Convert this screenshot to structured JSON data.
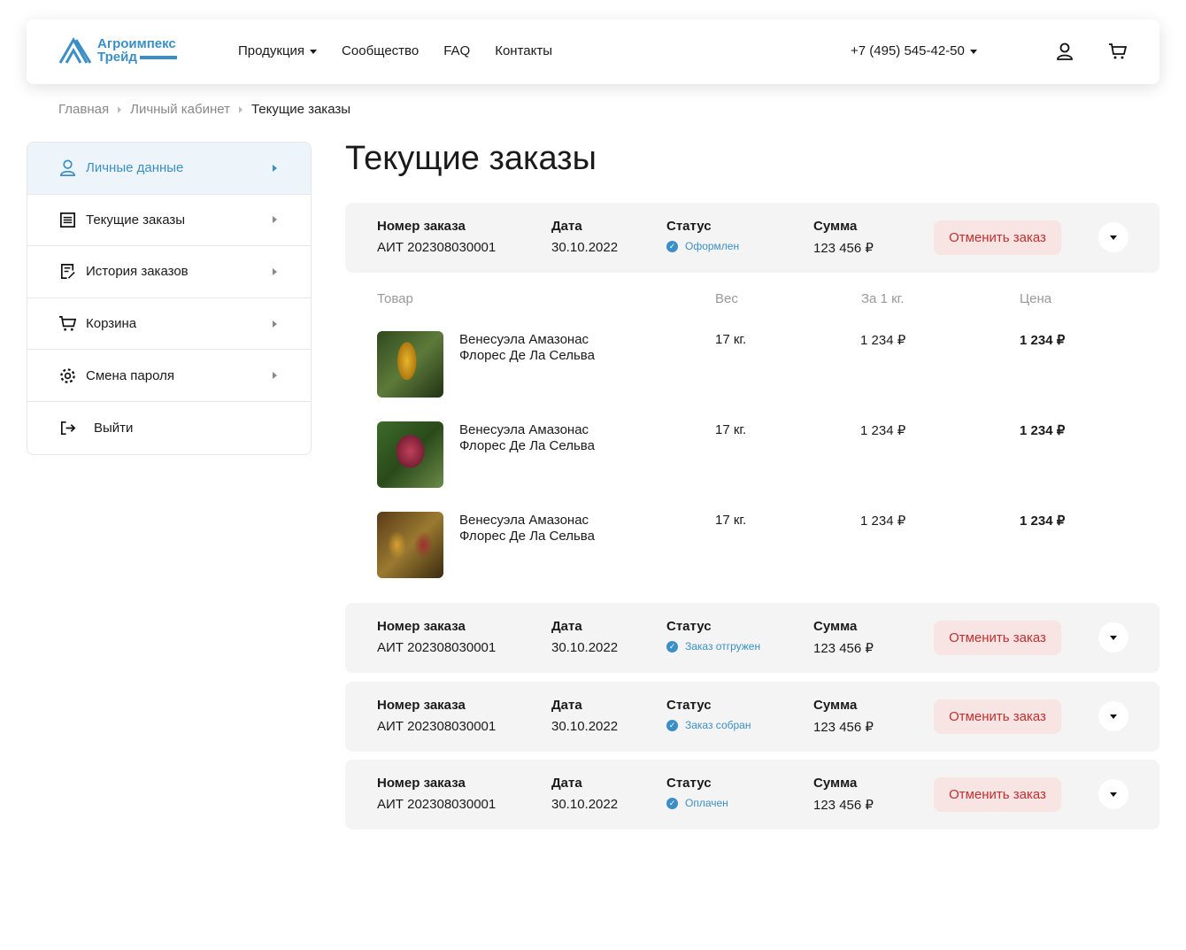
{
  "header": {
    "logo": {
      "line1": "Агроимпекс",
      "line2": "Трейд"
    },
    "nav": [
      {
        "label": "Продукция",
        "dropdown": true
      },
      {
        "label": "Сообщество"
      },
      {
        "label": "FAQ"
      },
      {
        "label": "Контакты"
      }
    ],
    "phone": "+7 (495) 545-42-50",
    "icons": [
      "user-icon",
      "cart-icon"
    ]
  },
  "breadcrumbs": [
    "Главная",
    "Личный кабинет",
    "Текущие заказы"
  ],
  "sidebar": {
    "items": [
      {
        "label": "Личные данные",
        "icon": "user-icon",
        "active": true
      },
      {
        "label": "Текущие заказы",
        "icon": "receipt-icon"
      },
      {
        "label": "История заказов",
        "icon": "history-icon"
      },
      {
        "label": "Корзина",
        "icon": "cart-icon"
      },
      {
        "label": "Смена пароля",
        "icon": "gear-icon"
      },
      {
        "label": "Выйти",
        "icon": "logout-icon"
      }
    ]
  },
  "page_title": "Текущие заказы",
  "labels": {
    "order_no": "Номер заказа",
    "date": "Дата",
    "status": "Статус",
    "sum": "Сумма",
    "cancel": "Отменить заказ"
  },
  "items_header": {
    "product": "Товар",
    "weight": "Вес",
    "per_kg": "За 1 кг.",
    "price": "Цена"
  },
  "orders": [
    {
      "number": "АИТ 202308030001",
      "date": "30.10.2022",
      "status": "Оформлен",
      "sum": "123 456 ₽",
      "expanded": true,
      "items": [
        {
          "name1": "Венесуэла Амазонас",
          "name2": "Флорес Де Ла Сельва",
          "weight": "17 кг.",
          "per_kg": "1 234 ₽",
          "price": "1 234 ₽"
        },
        {
          "name1": "Венесуэла Амазонас",
          "name2": "Флорес Де Ла Сельва",
          "weight": "17 кг.",
          "per_kg": "1 234 ₽",
          "price": "1 234 ₽"
        },
        {
          "name1": "Венесуэла Амазонас",
          "name2": "Флорес Де Ла Сельва",
          "weight": "17 кг.",
          "per_kg": "1 234 ₽",
          "price": "1 234 ₽"
        }
      ]
    },
    {
      "number": "АИТ 202308030001",
      "date": "30.10.2022",
      "status": "Заказ отгружен",
      "sum": "123 456 ₽"
    },
    {
      "number": "АИТ 202308030001",
      "date": "30.10.2022",
      "status": "Заказ собран",
      "sum": "123 456 ₽"
    },
    {
      "number": "АИТ 202308030001",
      "date": "30.10.2022",
      "status": "Оплачен",
      "sum": "123 456 ₽"
    }
  ],
  "colors": {
    "accent": "#3b8fc6",
    "cancel_bg": "#f9e4e4",
    "cancel_text": "#c0302f",
    "card_bg": "#f4f4f4"
  }
}
